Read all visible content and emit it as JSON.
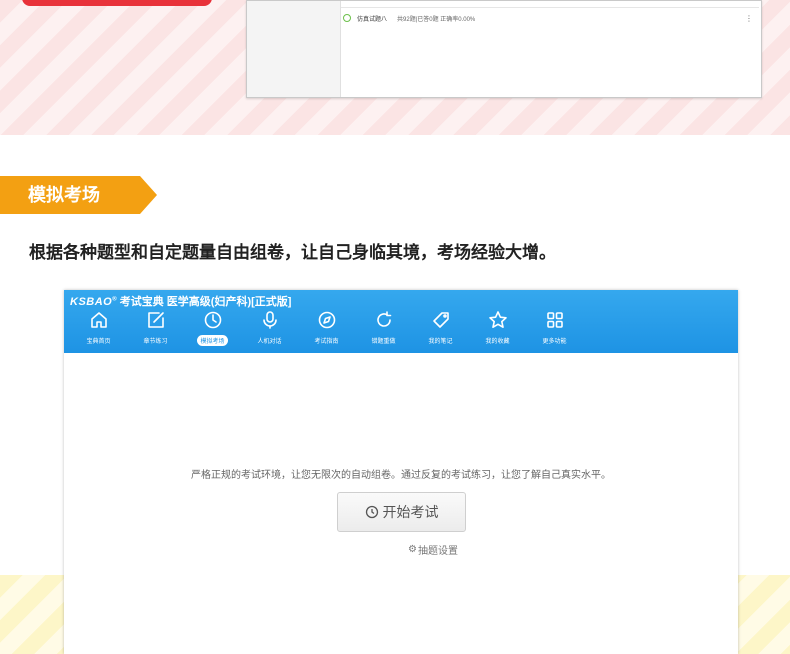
{
  "top_window": {
    "row_name": "仿真试题八",
    "row_meta": "共92题|已答0题   正确率0.00%",
    "more_icon": "⋮"
  },
  "section": {
    "tag": "模拟考场",
    "description": "根据各种题型和自定题量自由组卷，让自己身临其境，考场经验大增。"
  },
  "app": {
    "brand": "KSBAO",
    "brand_sup": "®",
    "product": "考试宝典",
    "subtitle": "医学高级(妇产科)[正式版]",
    "nav": [
      {
        "label": "宝典首页",
        "icon": "home-icon"
      },
      {
        "label": "章节练习",
        "icon": "edit-icon"
      },
      {
        "label": "模拟考场",
        "icon": "clock-icon",
        "active": true
      },
      {
        "label": "人机对话",
        "icon": "microphone-icon"
      },
      {
        "label": "考试指南",
        "icon": "compass-icon"
      },
      {
        "label": "错题重做",
        "icon": "refresh-icon"
      },
      {
        "label": "我的笔记",
        "icon": "tag-icon"
      },
      {
        "label": "我的收藏",
        "icon": "star-icon"
      },
      {
        "label": "更多功能",
        "icon": "grid-icon"
      }
    ],
    "intro": "严格正规的考试环境，让您无限次的自动组卷。通过反复的考试练习，让您了解自己真实水平。",
    "start_button": "开始考试",
    "settings_link": "抽题设置",
    "colors": {
      "header": "#1e93e4",
      "tag": "#f3a012"
    }
  }
}
